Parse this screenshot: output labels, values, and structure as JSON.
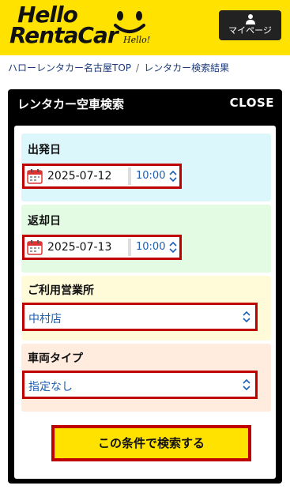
{
  "header": {
    "logo_line1": "Hello",
    "logo_line2": "RentaCar",
    "logo_sub": "Hello!",
    "mypage_label": "マイページ"
  },
  "breadcrumb": {
    "items": [
      "ハローレンタカー名古屋TOP",
      "レンタカー検索結果"
    ],
    "separator": "/"
  },
  "panel": {
    "title": "レンタカー空車検索",
    "close_label": "CLOSE",
    "departure": {
      "label": "出発日",
      "date": "2025-07-12",
      "time": "10:00"
    },
    "return": {
      "label": "返却日",
      "date": "2025-07-13",
      "time": "10:00"
    },
    "location": {
      "label": "ご利用営業所",
      "value": "中村店"
    },
    "vehicle": {
      "label": "車両タイプ",
      "value": "指定なし"
    },
    "search_label": "この条件で検索する"
  },
  "colors": {
    "brand_yellow": "#ffe200",
    "highlight_red": "#c00000",
    "link_blue": "#1d5fb0"
  }
}
